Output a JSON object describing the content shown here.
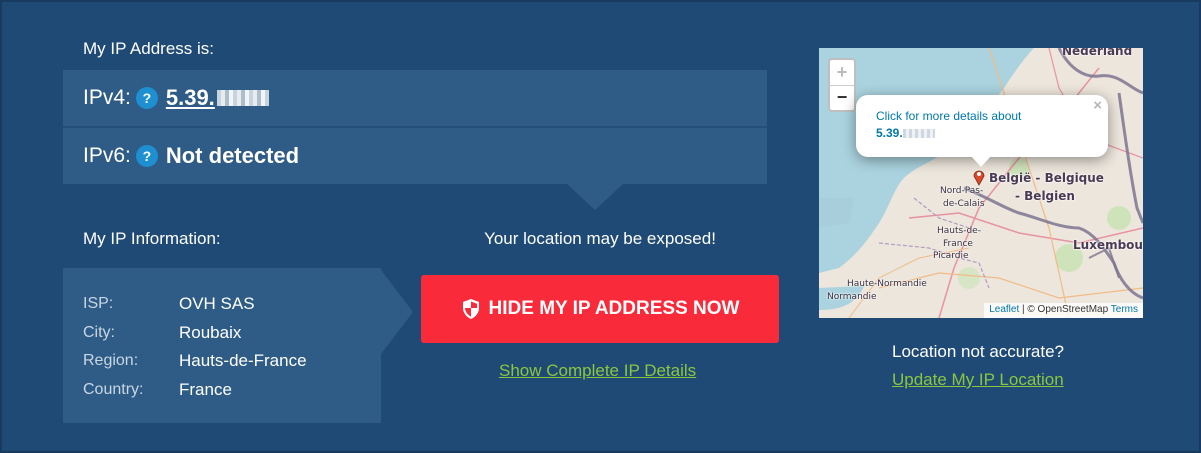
{
  "header": {
    "ip_title": "My IP Address is:"
  },
  "ipv4": {
    "label": "IPv4:",
    "help": "?",
    "value": "5.39."
  },
  "ipv6": {
    "label": "IPv6:",
    "help": "?",
    "value": "Not detected"
  },
  "info": {
    "title": "My IP Information:",
    "rows": [
      {
        "key": "ISP:",
        "value": "OVH SAS"
      },
      {
        "key": "City:",
        "value": "Roubaix"
      },
      {
        "key": "Region:",
        "value": "Hauts-de-France"
      },
      {
        "key": "Country:",
        "value": "France"
      }
    ]
  },
  "exposed_text": "Your location may be exposed!",
  "hide_button": {
    "label": "HIDE MY IP ADDRESS NOW",
    "icon": "shield-icon"
  },
  "details_link": "Show Complete IP Details",
  "map": {
    "zoom_in": "+",
    "zoom_out": "−",
    "popup_line1": "Click for more details about",
    "popup_ip": "5.39.",
    "popup_close": "×",
    "labels": {
      "nederland": "Nederland",
      "belgique": "België - Belgique",
      "belgien": "- Belgien",
      "luxembourg": "Luxembou",
      "nord": "Nord-Pas-",
      "calais": "de-Calais",
      "hauts": "Hauts-de-",
      "france": "France",
      "picardie": "Picardie",
      "haute_normandie": "Haute-Normandie",
      "normandie": "Normandie"
    },
    "attribution": {
      "leaflet": "Leaflet",
      "sep": "| © OpenStreetMap",
      "terms": "Terms"
    }
  },
  "location_question": "Location not accurate?",
  "update_link": "Update My IP Location",
  "colors": {
    "background": "#1f4a76",
    "panel": "#2f5c86",
    "cta": "#f92a3a",
    "link_green": "#8cc63f"
  }
}
